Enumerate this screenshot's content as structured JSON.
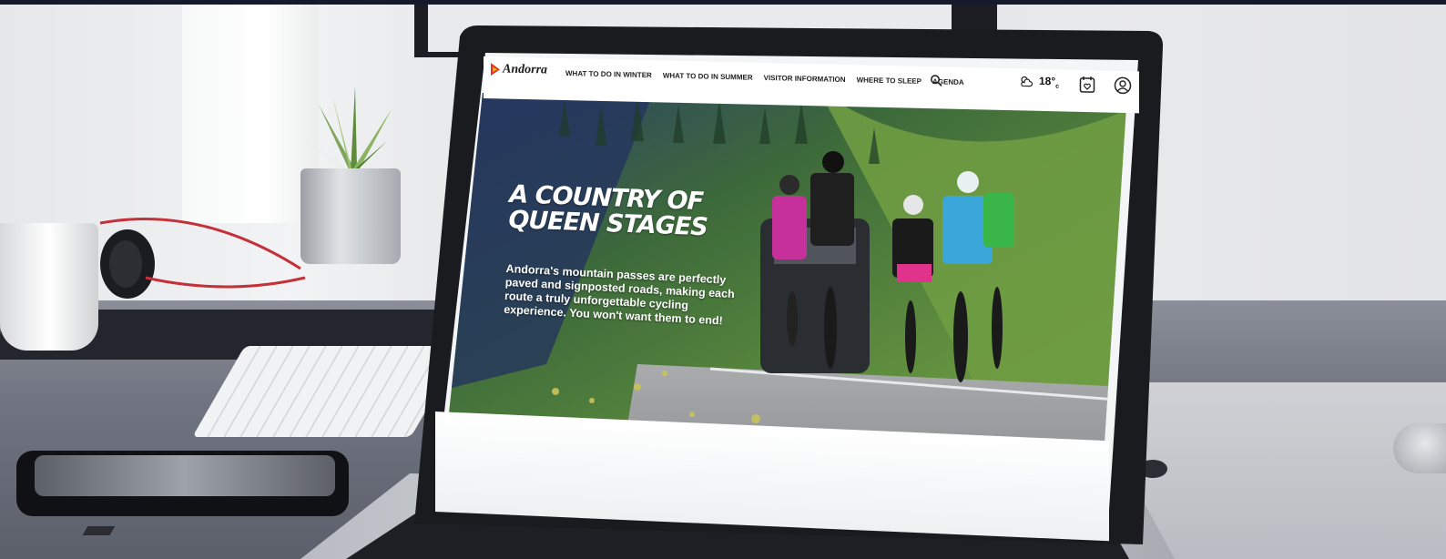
{
  "site": {
    "logo_text": "Andorra",
    "logo_colors": {
      "outer": "#e5332a",
      "inner": "#f6b700"
    }
  },
  "nav": {
    "items": [
      {
        "label": "WHAT TO DO IN WINTER"
      },
      {
        "label": "WHAT TO DO IN SUMMER"
      },
      {
        "label": "VISITOR INFORMATION"
      },
      {
        "label": "WHERE TO SLEEP"
      },
      {
        "label": "AGENDA"
      }
    ],
    "search_icon": "search-icon",
    "weather": {
      "icon": "partly-cloudy-icon",
      "temperature": "18°",
      "unit": "c"
    },
    "calendar_icon": "calendar-heart-icon",
    "account_icon": "user-icon"
  },
  "hero": {
    "title_line1": "A COUNTRY OF",
    "title_line2": "QUEEN STAGES",
    "text": "Andorra's mountain passes are perfectly paved and signposted roads, making each route a truly unforgettable cycling experience. You won't want them to end!"
  },
  "colors": {
    "top_bar": "#141a2c",
    "nav_bg": "#ffffff",
    "hero_green": "#3f6b2f",
    "text_dark": "#222222"
  }
}
